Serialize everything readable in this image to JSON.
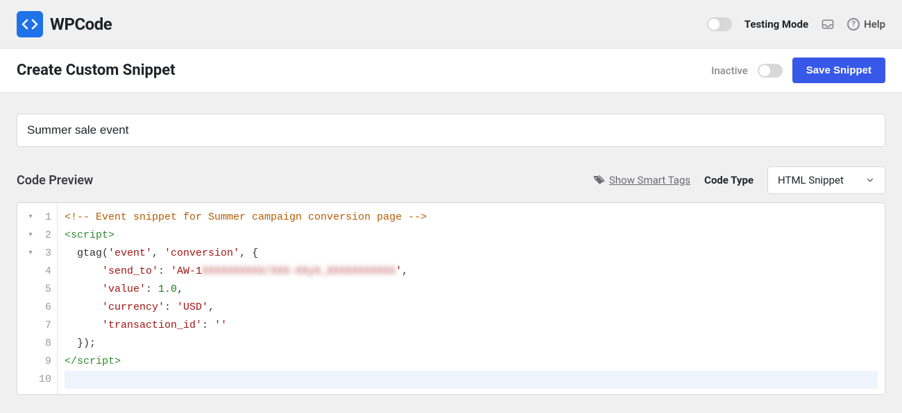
{
  "topbar": {
    "brand": "WPCode",
    "testing_mode_label": "Testing Mode",
    "help_label": "Help"
  },
  "header": {
    "title": "Create Custom Snippet",
    "status_label": "Inactive",
    "save_button": "Save Snippet"
  },
  "form": {
    "title_value": "Summer sale event"
  },
  "preview": {
    "label": "Code Preview",
    "smart_tags_label": "Show Smart Tags",
    "code_type_label": "Code Type",
    "code_type_value": "HTML Snippet"
  },
  "editor": {
    "lines": [
      {
        "n": 1,
        "fold": true
      },
      {
        "n": 2,
        "fold": true
      },
      {
        "n": 3,
        "fold": true
      },
      {
        "n": 4,
        "fold": false
      },
      {
        "n": 5,
        "fold": false
      },
      {
        "n": 6,
        "fold": false
      },
      {
        "n": 7,
        "fold": false
      },
      {
        "n": 8,
        "fold": false
      },
      {
        "n": 9,
        "fold": false
      },
      {
        "n": 10,
        "fold": false
      }
    ],
    "code": {
      "l1_comment": "<!-- Event snippet for Summer campaign conversion page -->",
      "l2_open": "<script>",
      "l3_a": "  gtag(",
      "l3_s1": "'event'",
      "l3_b": ", ",
      "l3_s2": "'conversion'",
      "l3_c": ", {",
      "l4_a": "      ",
      "l4_k": "'send_to'",
      "l4_b": ": ",
      "l4_v1": "'AW-1",
      "l4_blur": "XXXXXXXXXX/XXX-XXyX_XXXXXXXXXXX",
      "l4_v2": "'",
      "l4_c": ",",
      "l5_a": "      ",
      "l5_k": "'value'",
      "l5_b": ": ",
      "l5_v": "1.0",
      "l5_c": ",",
      "l6_a": "      ",
      "l6_k": "'currency'",
      "l6_b": ": ",
      "l6_v": "'USD'",
      "l6_c": ",",
      "l7_a": "      ",
      "l7_k": "'transaction_id'",
      "l7_b": ": ",
      "l7_v": "''",
      "l8": "  });",
      "l9_close": "</script>"
    }
  }
}
